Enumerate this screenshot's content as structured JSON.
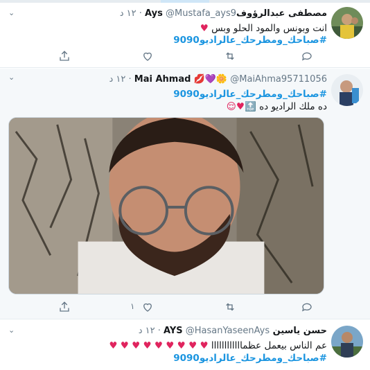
{
  "tweets": [
    {
      "name": "مصطفى عبدالرؤوفAys",
      "handle": "@Mustafa_ays9",
      "time": "١٢ د",
      "dot": "·",
      "lines": [
        {
          "text": "انت وبونس والمود الحلو وبس",
          "emoji": "♥"
        },
        {
          "hashtag": "#صباحك_ومطرحك_عالراديو9090"
        }
      ]
    },
    {
      "name": "Mai Ahmad",
      "name_emoji": "💋💜🌼",
      "handle": "@MaiAhma95711056",
      "time": "١٢ د",
      "dot": "·",
      "lines": [
        {
          "hashtag": "#صباحك_ومطرحك_عالراديو9090"
        },
        {
          "text": "ده ملك الراديو ده",
          "emoji": "🔝♥😌"
        }
      ],
      "retweet_count": "١"
    },
    {
      "name": "حسن ياسين AYS",
      "handle": "@HasanYaseenAys",
      "time": "١٢ د",
      "dot": "·",
      "lines": [
        {
          "text": "عم الناس بيعمل عظماااااااااااا",
          "emoji": "♥ ♥ ♥ ♥ ♥ ♥ ♥ ♥ ♥"
        },
        {
          "hashtag": "#صباحك_ومطرحك_عالراديو9090"
        }
      ]
    }
  ],
  "icons": {
    "caret": "chevron-down-icon",
    "share": "share-icon",
    "like": "heart-outline-icon",
    "retweet": "retweet-icon",
    "reply": "reply-icon"
  },
  "colors": {
    "hashtag": "#1b95e0",
    "heart": "#e0245e",
    "muted": "#657786",
    "border": "#e6ecf0"
  }
}
